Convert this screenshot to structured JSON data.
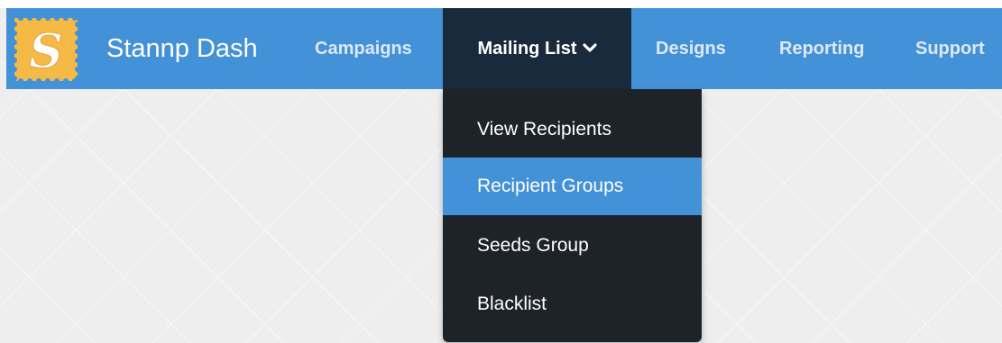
{
  "app": {
    "brand_name": "Stannp Dash",
    "logo_letter": "S"
  },
  "nav": {
    "items": [
      {
        "label": "Campaigns"
      },
      {
        "label": "Mailing List",
        "active": true
      },
      {
        "label": "Designs"
      },
      {
        "label": "Reporting"
      },
      {
        "label": "Support"
      }
    ]
  },
  "dropdown": {
    "items": [
      {
        "label": "View Recipients"
      },
      {
        "label": "Recipient Groups",
        "highlighted": true
      },
      {
        "label": "Seeds Group"
      },
      {
        "label": "Blacklist"
      }
    ]
  },
  "icons": {
    "logo": "stamp-logo-icon",
    "dropdown_indicator": "chevron-down-icon"
  },
  "colors": {
    "navbar": "#4391d7",
    "active_nav": "#192a3c",
    "dropdown_bg": "#1e2229",
    "highlight": "#4391d7",
    "logo_yellow": "#f5b945"
  }
}
